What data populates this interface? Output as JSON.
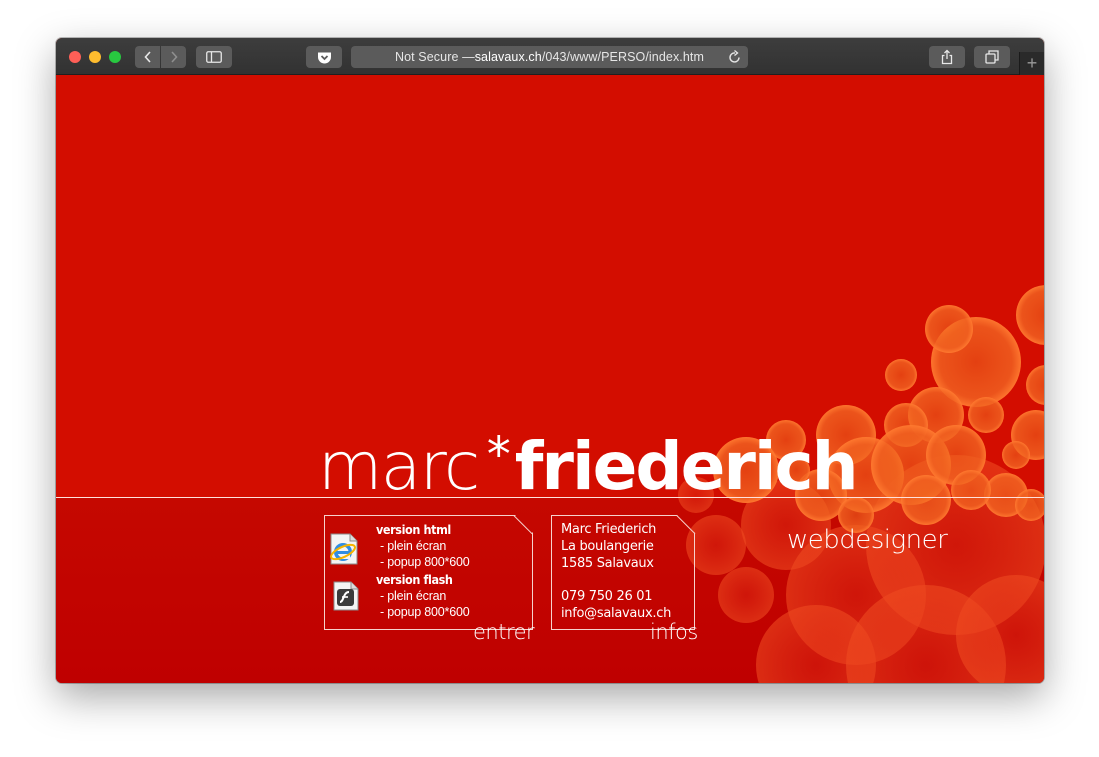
{
  "browser": {
    "address_prefix": "Not Secure — ",
    "address_domain": "salavaux.ch",
    "address_path": "/043/www/PERSO/index.htm",
    "new_tab_label": "+"
  },
  "page": {
    "brand_first": "marc",
    "brand_separator": "*",
    "brand_last": "friederich",
    "tagline": "webdesigner",
    "colors": {
      "background": "#d30d00",
      "band": "#c00000",
      "bubbles": "#f06020",
      "text": "#ffffff"
    },
    "versions": [
      {
        "title": "version html",
        "fullscreen": "- plein écran",
        "popup": "- popup 800*600",
        "icon": "internet-explorer-icon"
      },
      {
        "title": "version flash",
        "fullscreen": "- plein écran",
        "popup": "- popup 800*600",
        "icon": "flash-player-icon"
      }
    ],
    "enter_label": "entrer",
    "contact": {
      "name": "Marc Friederich",
      "street": "La boulangerie",
      "city": "1585 Salavaux",
      "phone": "079 750 26 01",
      "email": "info@salavaux.ch"
    },
    "infos_label": "infos"
  }
}
